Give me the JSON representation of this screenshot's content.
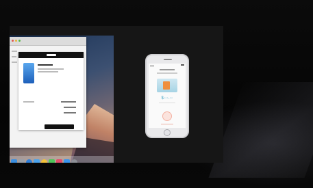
{
  "colors": {
    "stage": "#070707",
    "screen": "#161616",
    "phone_body": "#e9e9eb",
    "apple_pay_accent": "#4aa8c8",
    "touch_id": "#f4b3a4",
    "product": "#1d5fba"
  },
  "mac": {
    "pay_sheet": {
      "header_icon": "apple-pay-logo-icon"
    },
    "dock_icons": [
      "finder-icon",
      "launchpad-icon",
      "safari-icon",
      "mail-icon",
      "photos-icon",
      "messages-icon",
      "music-icon",
      "app-store-icon",
      "settings-icon"
    ]
  },
  "iphone": {
    "icons": [
      "shopping-bag-icon",
      "touch-id-icon",
      "home-button-icon"
    ]
  }
}
